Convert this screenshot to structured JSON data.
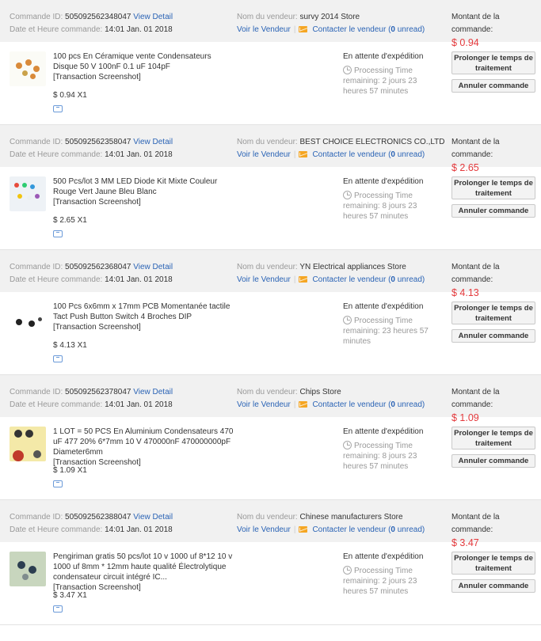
{
  "labels": {
    "order_id": "Commande ID:",
    "order_date": "Date et Heure commande:",
    "seller": "Nom du vendeur:",
    "view_detail": "View Detail",
    "view_seller": "Voir le Vendeur",
    "contact_seller": "Contacter le vendeur",
    "unread_open": "(",
    "unread_count": "0",
    "unread_close": " unread)",
    "amount": "Montant de la commande:",
    "snapshot": "[Transaction Screenshot]",
    "status": "En attente d'expédition",
    "processing": "Processing Time",
    "extend_btn": "Prolonger le temps de traitement",
    "cancel_btn": "Annuler commande"
  },
  "orders": [
    {
      "id": "505092562348047",
      "date": "14:01 Jan. 01 2018",
      "seller": "survy 2014 Store",
      "amount": "$ 0.94",
      "product": "100 pcs En Céramique vente Condensateurs Disque 50 V 100nF 0.1 uF 104pF",
      "price": "$ 0.94 X1",
      "remaining": "remaining: 2 jours 23 heures 57 minutes",
      "thumb_color": "#fbfbf6"
    },
    {
      "id": "505092562358047",
      "date": "14:01 Jan. 01 2018",
      "seller": "BEST CHOICE ELECTRONICS CO.,LTD",
      "amount": "$ 2.65",
      "product": "500 Pcs/lot 3 MM LED Diode Kit Mixte Couleur Rouge Vert Jaune Bleu Blanc",
      "price": "$ 2.65 X1",
      "remaining": "remaining: 8 jours 23 heures 57 minutes",
      "thumb_color": "#eef2f6"
    },
    {
      "id": "505092562368047",
      "date": "14:01 Jan. 01 2018",
      "seller": "YN Electrical appliances Store",
      "amount": "$ 4.13",
      "product": "100 Pcs 6x6mm x 17mm PCB Momentanée tactile Tact Push Button Switch 4 Broches DIP",
      "price": "$ 4.13 X1",
      "remaining": "remaining: 23 heures 57 minutes",
      "thumb_color": "#ffffff"
    },
    {
      "id": "505092562378047",
      "date": "14:01 Jan. 01 2018",
      "seller": "Chips Store",
      "amount": "$ 1.09",
      "product": "1 LOT = 50 PCS En Aluminium Condensateurs 470 uF 477 20% 6*7mm 10 V 470000nF 470000000pF Diameter6mm",
      "price": "$ 1.09 X1",
      "remaining": "remaining: 8 jours 23 heures 57 minutes",
      "thumb_color": "#f4e9a8"
    },
    {
      "id": "505092562388047",
      "date": "14:01 Jan. 01 2018",
      "seller": "Chinese manufacturers Store",
      "amount": "$ 3.47",
      "product": "Pengiriman gratis 50 pcs/lot 10 v 1000 uf 8*12 10 v 1000 uf 8mm * 12mm haute qualité Électrolytique condensateur circuit intégré IC...",
      "price": "$ 3.47 X1",
      "remaining": "remaining: 2 jours 23 heures 57 minutes",
      "thumb_color": "#c8d6be"
    }
  ]
}
